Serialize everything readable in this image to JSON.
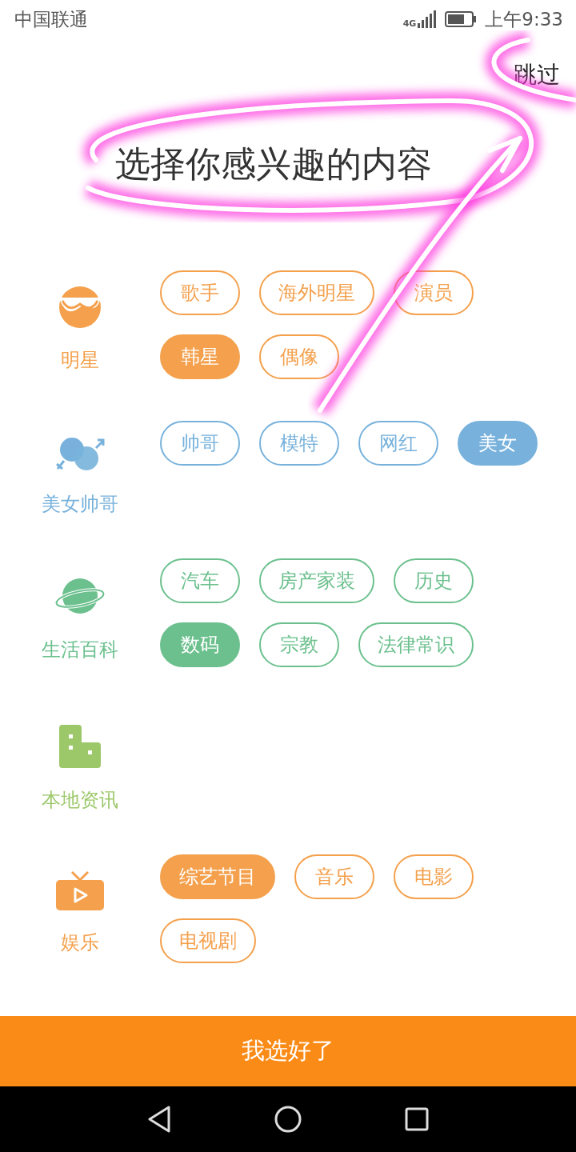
{
  "status_bar": {
    "carrier": "中国联通",
    "network": "4G",
    "time": "上午9:33"
  },
  "header": {
    "skip": "跳过",
    "title": "选择你感兴趣的内容"
  },
  "categories": [
    {
      "name": "明星",
      "kind": "glasses",
      "color": "#f4a04c",
      "tags": [
        {
          "label": "歌手",
          "selected": false
        },
        {
          "label": "海外明星",
          "selected": false
        },
        {
          "label": "演员",
          "selected": false
        },
        {
          "label": "韩星",
          "selected": true
        },
        {
          "label": "偶像",
          "selected": false
        }
      ]
    },
    {
      "name": "美女帅哥",
      "kind": "gender",
      "color": "#78b2dc",
      "tags": [
        {
          "label": "帅哥",
          "selected": false
        },
        {
          "label": "模特",
          "selected": false
        },
        {
          "label": "网红",
          "selected": false
        },
        {
          "label": "美女",
          "selected": true
        }
      ]
    },
    {
      "name": "生活百科",
      "kind": "planet",
      "color": "#6cc08e",
      "tags": [
        {
          "label": "汽车",
          "selected": false
        },
        {
          "label": "房产家装",
          "selected": false
        },
        {
          "label": "历史",
          "selected": false
        },
        {
          "label": "数码",
          "selected": true
        },
        {
          "label": "宗教",
          "selected": false
        },
        {
          "label": "法律常识",
          "selected": false
        }
      ]
    },
    {
      "name": "本地资讯",
      "kind": "building",
      "color": "#9cc86a"
    },
    {
      "name": "娱乐",
      "kind": "tv",
      "color": "#f4a04c",
      "tags": [
        {
          "label": "综艺节目",
          "selected": true
        },
        {
          "label": "音乐",
          "selected": false
        },
        {
          "label": "电影",
          "selected": false
        },
        {
          "label": "电视剧",
          "selected": false
        }
      ]
    }
  ],
  "confirm_button": "我选好了"
}
